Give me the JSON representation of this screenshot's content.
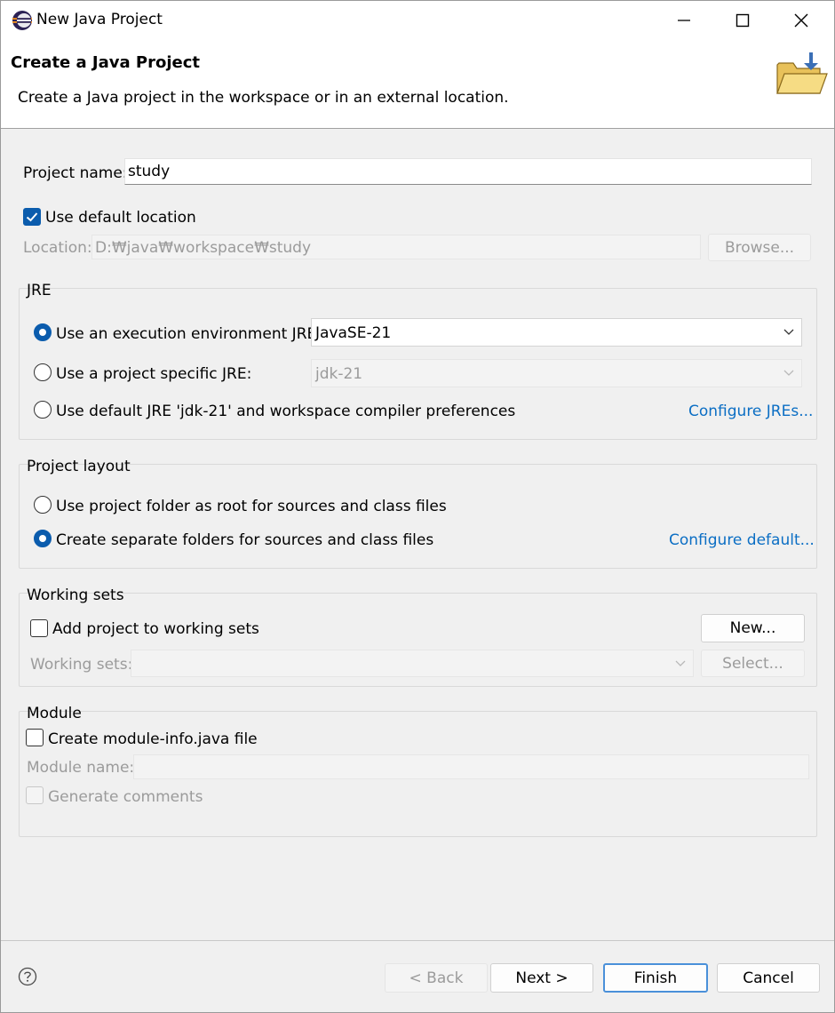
{
  "window": {
    "title": "New Java Project"
  },
  "banner": {
    "title": "Create a Java Project",
    "description": "Create a Java project in the workspace or in an external location."
  },
  "project": {
    "name_label": "Project name:",
    "name_value": "study",
    "use_default_location_label": "Use default location",
    "use_default_location_checked": true,
    "location_label": "Location:",
    "location_value": "D:₩java₩workspace₩study",
    "browse_label": "Browse..."
  },
  "jre": {
    "group_label": "JRE",
    "option_execution_env_label": "Use an execution environment JRE:",
    "execution_env_value": "JavaSE-21",
    "option_project_specific_label": "Use a project specific JRE:",
    "project_specific_value": "jdk-21",
    "option_default_label": "Use default JRE 'jdk-21' and workspace compiler preferences",
    "configure_link": "Configure JREs...",
    "selected": "execution_env"
  },
  "layout": {
    "group_label": "Project layout",
    "option_root_label": "Use project folder as root for sources and class files",
    "option_separate_label": "Create separate folders for sources and class files",
    "configure_link": "Configure default...",
    "selected": "separate"
  },
  "working_sets": {
    "group_label": "Working sets",
    "add_label": "Add project to working sets",
    "add_checked": false,
    "new_button": "New...",
    "sets_label": "Working sets:",
    "sets_value": "",
    "select_button": "Select..."
  },
  "module": {
    "group_label": "Module",
    "create_label": "Create module-info.java file",
    "create_checked": false,
    "name_label": "Module name:",
    "name_value": "",
    "comments_label": "Generate comments"
  },
  "footer": {
    "back_button": "< Back",
    "next_button": "Next >",
    "finish_button": "Finish",
    "cancel_button": "Cancel"
  },
  "colors": {
    "accent": "#0b5cad",
    "link": "#0b6ec4"
  },
  "icons": [
    "eclipse-icon",
    "minimize-icon",
    "maximize-icon",
    "close-icon",
    "folder-icon",
    "help-icon",
    "chevron-down-icon",
    "checkmark-icon"
  ]
}
